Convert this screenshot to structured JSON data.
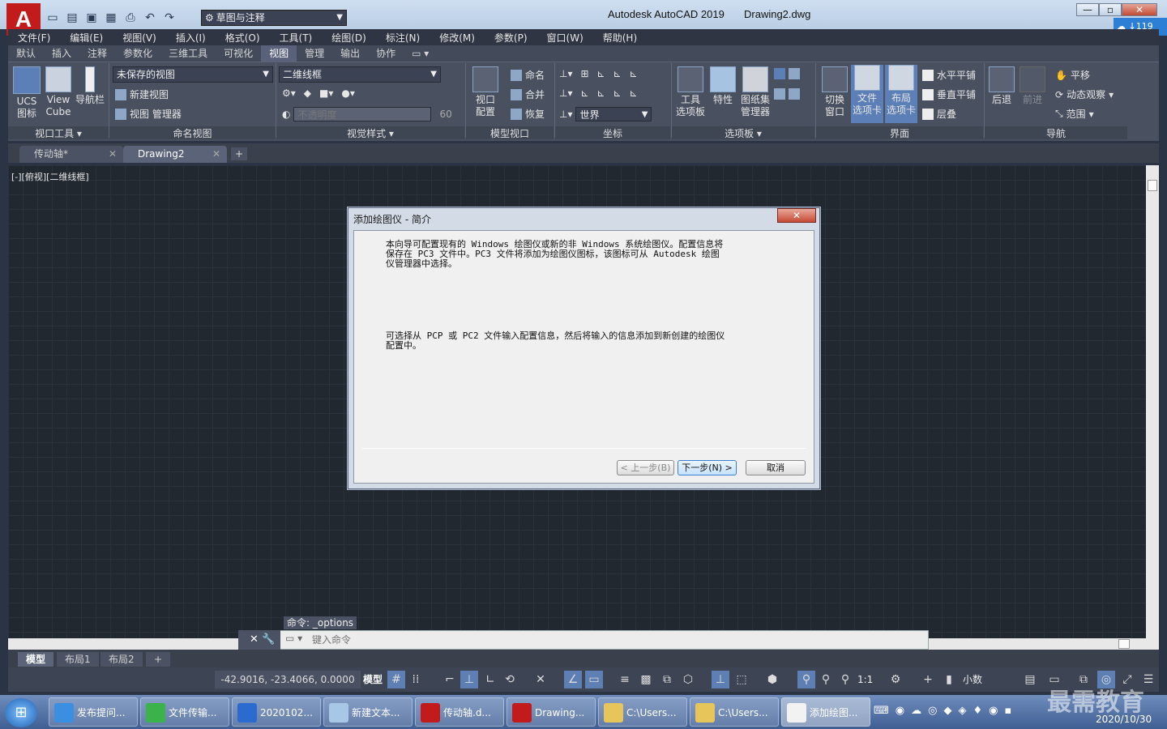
{
  "app": {
    "logo": "A",
    "title": "Autodesk AutoCAD 2019",
    "document": "Drawing2.dwg",
    "workspace": "草图与注释",
    "cloud_badge": "119"
  },
  "menu": [
    "文件(F)",
    "编辑(E)",
    "视图(V)",
    "插入(I)",
    "格式(O)",
    "工具(T)",
    "绘图(D)",
    "标注(N)",
    "修改(M)",
    "参数(P)",
    "窗口(W)",
    "帮助(H)"
  ],
  "ribbon_tabs": [
    "默认",
    "插入",
    "注释",
    "参数化",
    "三维工具",
    "可视化",
    "视图",
    "管理",
    "输出",
    "协作"
  ],
  "ribbon_active_tab": "视图",
  "ribbon": {
    "viewport_tools": {
      "ucs": "UCS\n图标",
      "viewcube": "View\nCube",
      "navbar": "导航栏",
      "title": "视口工具 ▾"
    },
    "named_views": {
      "combo": "未保存的视图",
      "new_view": "新建视图",
      "view_manager": "视图 管理器",
      "title": "命名视图"
    },
    "visual_styles": {
      "combo": "二维线框",
      "opacity": "不透明度",
      "opacity_value": "60",
      "title": "视觉样式 ▾"
    },
    "model_viewports": {
      "config": "视口\n配置",
      "name": "命名",
      "join": "合并",
      "restore": "恢复",
      "title": "模型视口"
    },
    "coordinates": {
      "world": "世界",
      "title": "坐标"
    },
    "palettes": {
      "tool_palettes": "工具\n选项板",
      "properties": "特性",
      "sheet_set": "图纸集\n管理器",
      "title": "选项板 ▾"
    },
    "interface": {
      "switch_windows": "切换\n窗口",
      "file_tabs": "文件\n选项卡",
      "layout_tabs": "布局\n选项卡",
      "tile_h": "水平平铺",
      "tile_v": "垂直平铺",
      "cascade": "层叠",
      "title": "界面"
    },
    "navigate": {
      "back": "后退",
      "forward": "前进",
      "pan": "平移",
      "orbit": "动态观察",
      "extents": "范围",
      "title": "导航"
    }
  },
  "doc_tabs": [
    {
      "label": "传动轴*",
      "active": false
    },
    {
      "label": "Drawing2",
      "active": true
    }
  ],
  "viewport_label": "[-][俯视][二维线框]",
  "command": {
    "history": "命令: _options",
    "placeholder": "键入命令"
  },
  "layout_tabs": [
    "模型",
    "布局1",
    "布局2"
  ],
  "status": {
    "coords": "-42.9016, -23.4066, 0.0000",
    "model": "模型",
    "scale": "1:1",
    "units": "小数"
  },
  "dialog": {
    "title": "添加绘图仪 - 简介",
    "close": "✕",
    "para1": "本向导可配置现有的 Windows 绘图仪或新的非 Windows 系统绘图仪。配置信息将保存在 PC3 文件中。PC3 文件将添加为绘图仪图标，该图标可从 Autodesk 绘图仪管理器中选择。",
    "para2": "可选择从 PCP 或 PC2 文件输入配置信息，然后将输入的信息添加到新创建的绘图仪配置中。",
    "back": "< 上一步(B)",
    "next": "下一步(N) >",
    "cancel": "取消"
  },
  "taskbar": {
    "tasks": [
      "发布提问...",
      "文件传输...",
      "2020102...",
      "新建文本...",
      "传动轴.d...",
      "Drawing...",
      "C:\\Users...",
      "C:\\Users...",
      "添加绘图..."
    ],
    "date": "2020/10/30",
    "watermark": "最需教育"
  },
  "colors": {
    "accent": "#5b7fb6",
    "canvas": "#212830",
    "autocad_red": "#c21b1b"
  }
}
